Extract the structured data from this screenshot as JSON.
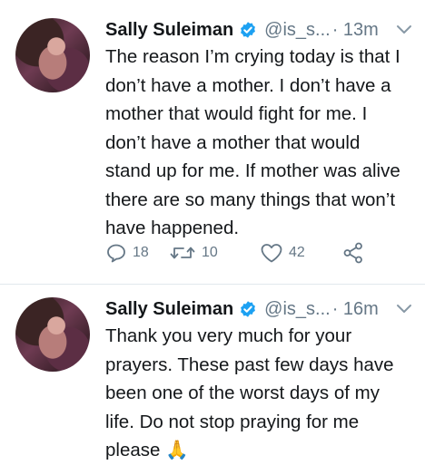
{
  "tweets": [
    {
      "name": "Sally Suleiman",
      "handle": "@is_s...",
      "time": "· 13m",
      "text": "The reason I’m crying today is that I\ndon’t have a mother. I don’t have a\nmother that would fight for me. I\ndon’t have a mother that would\nstand up for me. If mother was alive\nthere are so many things that won’t\nhave happened.",
      "replies": "18",
      "retweets": "10",
      "likes": "42"
    },
    {
      "name": "Sally Suleiman",
      "handle": "@is_s...",
      "time": "· 16m",
      "text": "Thank you very much for your\nprayers. These past few days have\nbeen one of the worst days of my\nlife.  Do not stop praying for me\nplease 🙏"
    }
  ],
  "colors": {
    "verified": "#1da1f2",
    "secondary_text": "#657786",
    "primary_text": "#14171a",
    "divider": "#e1e8ed"
  },
  "icons": [
    "verified-badge-icon",
    "chevron-down-icon",
    "reply-icon",
    "retweet-icon",
    "like-icon",
    "share-icon"
  ]
}
